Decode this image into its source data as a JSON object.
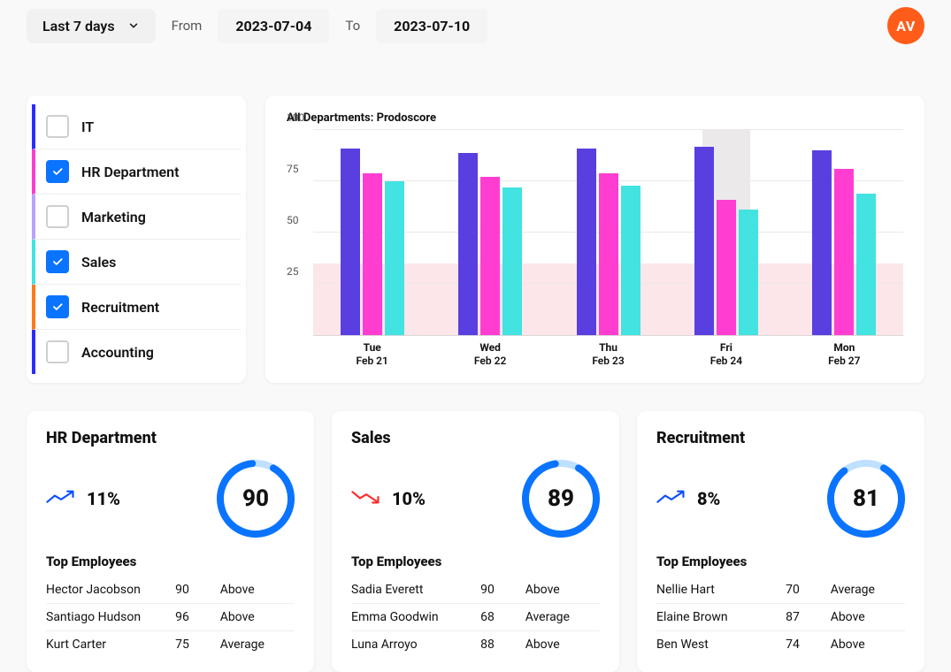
{
  "header": {
    "range_label": "Last 7 days",
    "from_label": "From",
    "to_label": "To",
    "from_date": "2023-07-04",
    "to_date": "2023-07-10",
    "avatar_initials": "AV"
  },
  "departments": [
    {
      "name": "IT",
      "checked": false,
      "color": "#2b2bff"
    },
    {
      "name": "HR Department",
      "checked": true,
      "color": "#ff3ed1"
    },
    {
      "name": "Marketing",
      "checked": false,
      "color": "#b8a2ff"
    },
    {
      "name": "Sales",
      "checked": true,
      "color": "#42e3e0"
    },
    {
      "name": "Recruitment",
      "checked": true,
      "color": "#ff7a1a"
    },
    {
      "name": "Accounting",
      "checked": false,
      "color": "#2b2bff"
    }
  ],
  "chart_data": {
    "type": "bar",
    "title": "All Departments: Prodoscore",
    "ylabel": "",
    "xlabel": "",
    "ylim": [
      0,
      100
    ],
    "yticks": [
      25,
      50,
      75,
      100
    ],
    "categories": [
      "Tue Feb 21",
      "Wed Feb 22",
      "Thu Feb 23",
      "Fri Feb 24",
      "Mon Feb 27"
    ],
    "series": [
      {
        "name": "IT",
        "color": "#5a3fe0",
        "values": [
          91,
          89,
          91,
          92,
          90
        ]
      },
      {
        "name": "HR Department",
        "color": "#ff3ed1",
        "values": [
          79,
          77,
          79,
          66,
          81
        ]
      },
      {
        "name": "Sales",
        "color": "#42e3e0",
        "values": [
          75,
          72,
          73,
          61,
          69
        ]
      }
    ],
    "red_band": [
      0,
      35
    ],
    "highlight_index": 3
  },
  "cards": [
    {
      "title": "HR Department",
      "trend": {
        "direction": "up",
        "value": "11%"
      },
      "score": 90,
      "top_label": "Top Employees",
      "employees": [
        {
          "name": "Hector Jacobson",
          "score": 90,
          "status": "Above"
        },
        {
          "name": "Santiago Hudson",
          "score": 96,
          "status": "Above"
        },
        {
          "name": "Kurt Carter",
          "score": 75,
          "status": "Average"
        }
      ]
    },
    {
      "title": "Sales",
      "trend": {
        "direction": "down",
        "value": "10%"
      },
      "score": 89,
      "top_label": "Top Employees",
      "employees": [
        {
          "name": "Sadia Everett",
          "score": 90,
          "status": "Above"
        },
        {
          "name": "Emma Goodwin",
          "score": 68,
          "status": "Average"
        },
        {
          "name": "Luna Arroyo",
          "score": 88,
          "status": "Above"
        }
      ]
    },
    {
      "title": "Recruitment",
      "trend": {
        "direction": "up",
        "value": "8%"
      },
      "score": 81,
      "top_label": "Top Employees",
      "employees": [
        {
          "name": "Nellie Hart",
          "score": 70,
          "status": "Average"
        },
        {
          "name": "Elaine Brown",
          "score": 87,
          "status": "Above"
        },
        {
          "name": "Ben West",
          "score": 74,
          "status": "Above"
        }
      ]
    }
  ]
}
